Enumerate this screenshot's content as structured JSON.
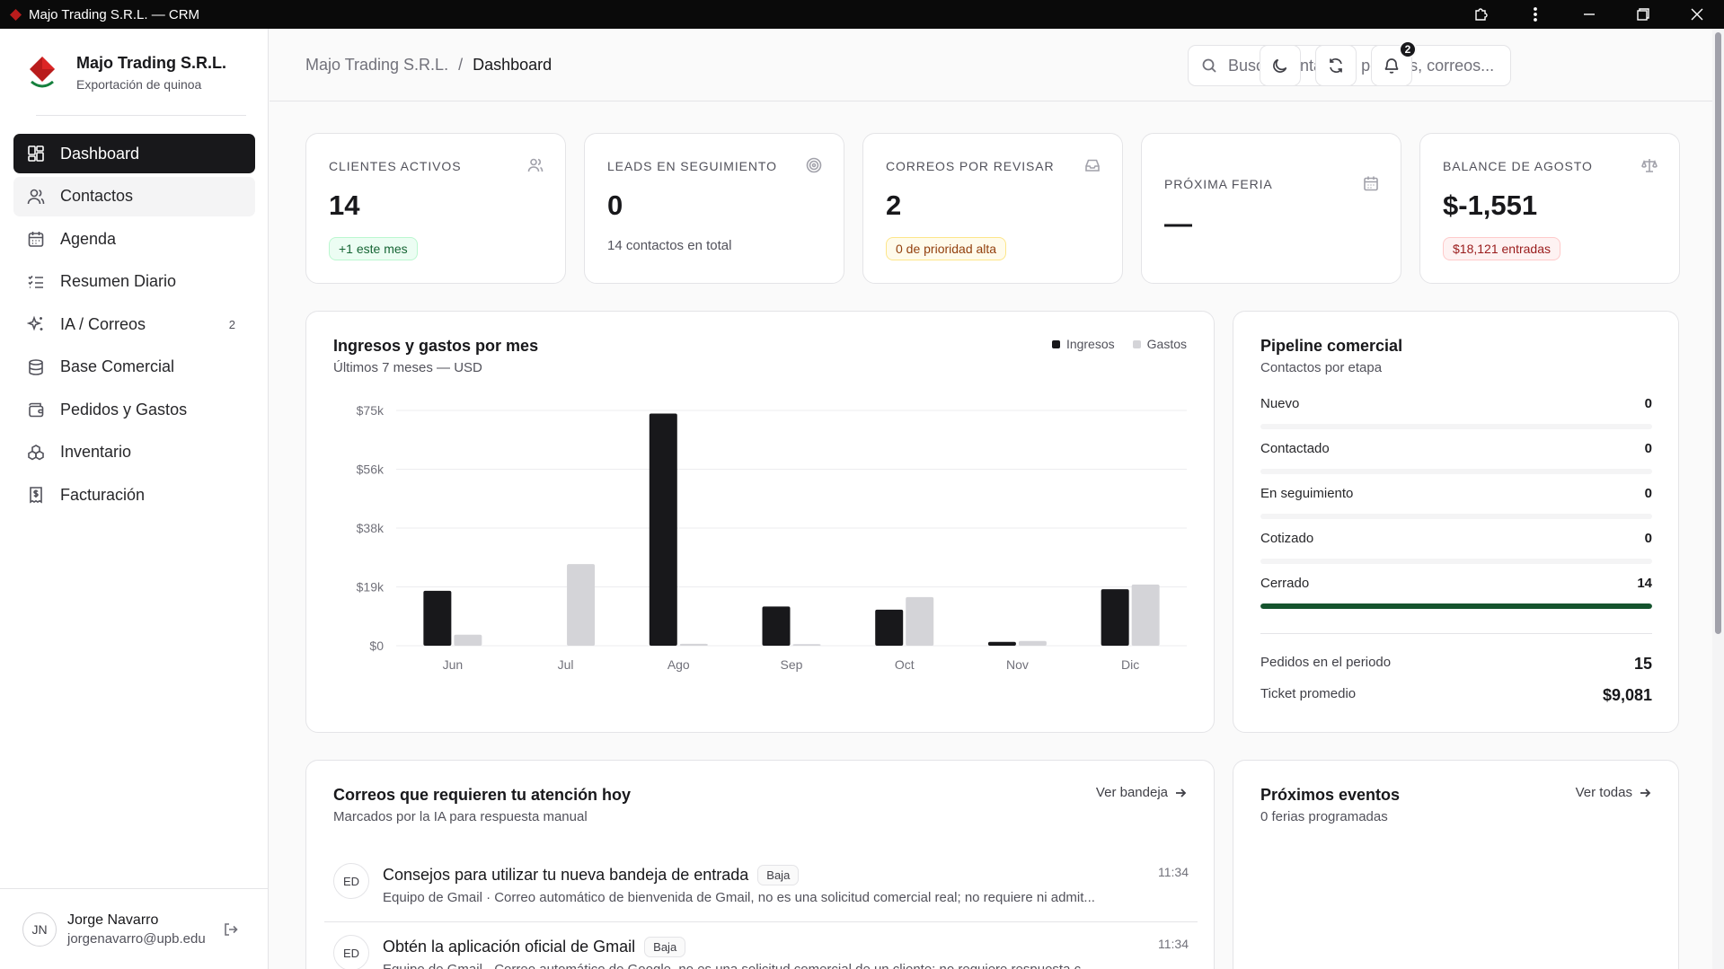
{
  "window": {
    "title": "Majo Trading S.R.L. — CRM"
  },
  "brand": {
    "name": "Majo Trading S.R.L.",
    "subtitle": "Exportación de quinoa"
  },
  "sidebar": {
    "items": [
      {
        "label": "Dashboard",
        "icon": "dashboard-icon",
        "active": true
      },
      {
        "label": "Contactos",
        "icon": "users-icon"
      },
      {
        "label": "Agenda",
        "icon": "calendar-icon"
      },
      {
        "label": "Resumen Diario",
        "icon": "checklist-icon"
      },
      {
        "label": "IA / Correos",
        "icon": "sparkles-icon",
        "badge": "2"
      },
      {
        "label": "Base Comercial",
        "icon": "database-icon"
      },
      {
        "label": "Pedidos y Gastos",
        "icon": "wallet-icon"
      },
      {
        "label": "Inventario",
        "icon": "boxes-icon"
      },
      {
        "label": "Facturación",
        "icon": "receipt-icon"
      }
    ]
  },
  "user": {
    "initials": "JN",
    "name": "Jorge Navarro",
    "email": "jorgenavarro@upb.edu"
  },
  "header": {
    "breadcrumb_root": "Majo Trading S.R.L.",
    "breadcrumb_sep": "/",
    "breadcrumb_current": "Dashboard",
    "search_placeholder": "Buscar contactos, pedidos, correos...",
    "notifications_count": "2"
  },
  "stats": [
    {
      "label": "CLIENTES ACTIVOS",
      "value": "14",
      "pill": "+1 este mes",
      "icon": "users-icon"
    },
    {
      "label": "LEADS EN SEGUIMIENTO",
      "value": "0",
      "note": "14 contactos en total",
      "icon": "target-icon"
    },
    {
      "label": "CORREOS POR REVISAR",
      "value": "2",
      "pill": "0 de prioridad alta",
      "icon": "inbox-icon"
    },
    {
      "label": "PRÓXIMA FERIA",
      "value": "—",
      "icon": "calendar-icon"
    },
    {
      "label": "BALANCE DE AGOSTO",
      "value": "$-1,551",
      "pill": "$18,121 entradas",
      "icon": "scale-icon"
    }
  ],
  "chart_card": {
    "title": "Ingresos y gastos por mes",
    "subtitle": "Últimos 7 meses — USD"
  },
  "chart_data": {
    "type": "bar",
    "title": "Ingresos y gastos por mes",
    "categories": [
      "Jun",
      "Jul",
      "Ago",
      "Sep",
      "Oct",
      "Nov",
      "Dic"
    ],
    "series": [
      {
        "name": "Ingresos",
        "color": "#18181b",
        "values": [
          17500,
          0,
          74000,
          12500,
          11500,
          1200,
          18000
        ]
      },
      {
        "name": "Gastos",
        "color": "#d4d4d8",
        "values": [
          3500,
          26000,
          600,
          500,
          15500,
          1500,
          19500
        ]
      }
    ],
    "yticks": [
      "$0",
      "$19k",
      "$38k",
      "$56k",
      "$75k"
    ],
    "ylim": [
      0,
      75000
    ],
    "grid": true,
    "legend": "top-right"
  },
  "pipeline": {
    "title": "Pipeline comercial",
    "subtitle": "Contactos por etapa",
    "stages": [
      {
        "label": "Nuevo",
        "count": "0",
        "fraction": 0
      },
      {
        "label": "Contactado",
        "count": "0",
        "fraction": 0
      },
      {
        "label": "En seguimiento",
        "count": "0",
        "fraction": 0
      },
      {
        "label": "Cotizado",
        "count": "0",
        "fraction": 0
      },
      {
        "label": "Cerrado",
        "count": "14",
        "fraction": 1
      }
    ],
    "orders_label": "Pedidos en el periodo",
    "orders_value": "15",
    "ticket_label": "Ticket promedio",
    "ticket_value": "$9,081"
  },
  "emails": {
    "title": "Correos que requieren tu atención hoy",
    "subtitle": "Marcados por la IA para respuesta manual",
    "link": "Ver bandeja",
    "items": [
      {
        "initials": "ED",
        "subject": "Consejos para utilizar tu nueva bandeja de entrada",
        "tag": "Baja",
        "time": "11:34",
        "snippet": "Equipo de Gmail · Correo automático de bienvenida de Gmail, no es una solicitud comercial real; no requiere ni admit..."
      },
      {
        "initials": "ED",
        "subject": "Obtén la aplicación oficial de Gmail",
        "tag": "Baja",
        "time": "11:34",
        "snippet": "Equipo de Gmail · Correo automático de Google, no es una solicitud comercial de un cliente; no requiere respuesta c..."
      }
    ]
  },
  "events": {
    "title": "Próximos eventos",
    "subtitle": "0 ferias programadas",
    "link": "Ver todas"
  }
}
